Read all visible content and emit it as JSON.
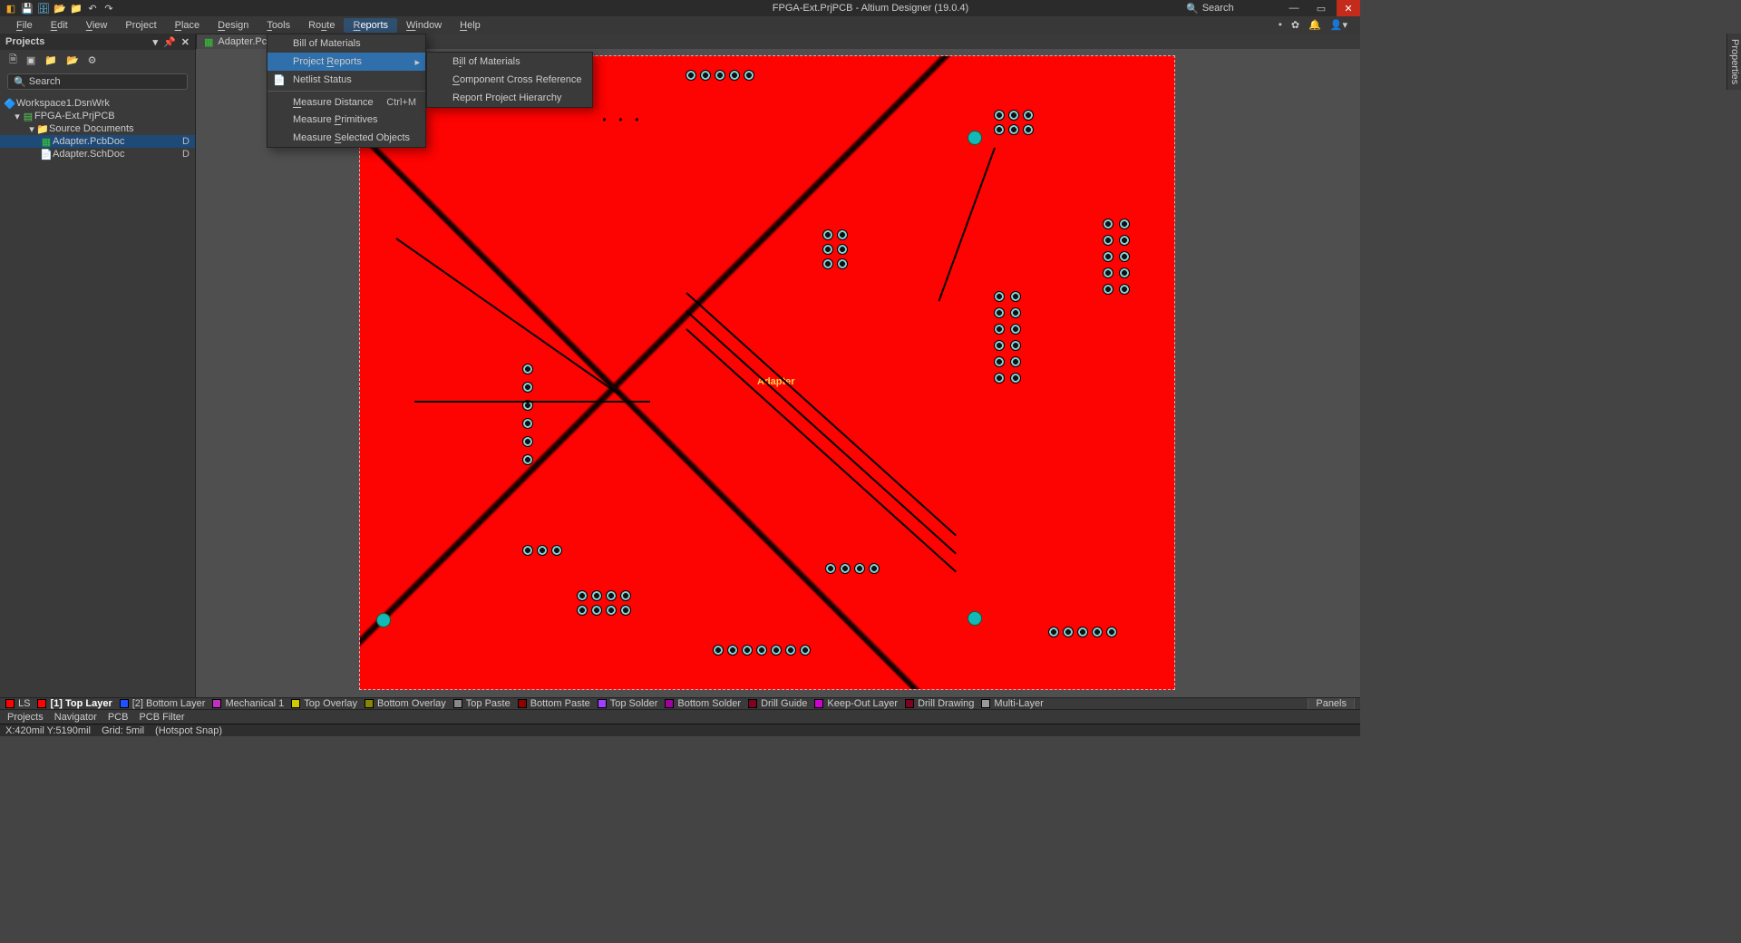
{
  "title": "FPGA-Ext.PrjPCB - Altium Designer (19.0.4)",
  "search_placeholder": "Search",
  "menu": {
    "file": "File",
    "edit": "Edit",
    "view": "View",
    "project": "Project",
    "place": "Place",
    "design": "Design",
    "tools": "Tools",
    "route": "Route",
    "reports": "Reports",
    "window": "Window",
    "help": "Help"
  },
  "projects_panel": {
    "title": "Projects",
    "search_placeholder": "Search",
    "workspace": "Workspace1.DsnWrk",
    "project": "FPGA-Ext.PrjPCB",
    "folder": "Source Documents",
    "pcbdoc": "Adapter.PcbDoc",
    "schdoc": "Adapter.SchDoc",
    "badge": "D"
  },
  "doc_tab": "Adapter.PcbD",
  "properties_tab": "Properties",
  "dropdown_reports": {
    "bom": "Bill of Materials",
    "project_reports": "Project Reports",
    "netlist": "Netlist Status",
    "measure_distance": "Measure Distance",
    "measure_distance_sc": "Ctrl+M",
    "measure_primitives": "Measure Primitives",
    "measure_selected": "Measure Selected Objects"
  },
  "submenu_project_reports": {
    "bom": "Bill of Materials",
    "cross": "Component Cross Reference",
    "hierarchy": "Report Project Hierarchy"
  },
  "pcb_label": "Adapter",
  "layers": {
    "ls": "LS",
    "l1": "[1] Top Layer",
    "l2": "[2] Bottom Layer",
    "mech": "Mechanical 1",
    "to": "Top Overlay",
    "bo": "Bottom Overlay",
    "tp": "Top Paste",
    "bp": "Bottom Paste",
    "ts": "Top Solder",
    "bs": "Bottom Solder",
    "dg": "Drill Guide",
    "ko": "Keep-Out Layer",
    "dd": "Drill Drawing",
    "ml": "Multi-Layer",
    "panels": "Panels"
  },
  "bottom_panels": {
    "projects": "Projects",
    "navigator": "Navigator",
    "pcb": "PCB",
    "filter": "PCB Filter"
  },
  "status": {
    "coord": "X:420mil Y:5190mil",
    "grid": "Grid: 5mil",
    "snap": "(Hotspot Snap)"
  },
  "colors": {
    "pcb_red": "#fd0302",
    "accent": "#2f6fab",
    "top": "#fd0302",
    "bottom": "#2050ff",
    "mech": "#c030c0",
    "overlay": "#cccc00",
    "overlay2": "#888800",
    "paste": "#888",
    "paste2": "#8b0000",
    "solder": "#a040ff",
    "solder2": "#a000a0",
    "drill": "#800020",
    "keepout": "#d000d0",
    "dd": "#800020",
    "ml": "#999"
  }
}
